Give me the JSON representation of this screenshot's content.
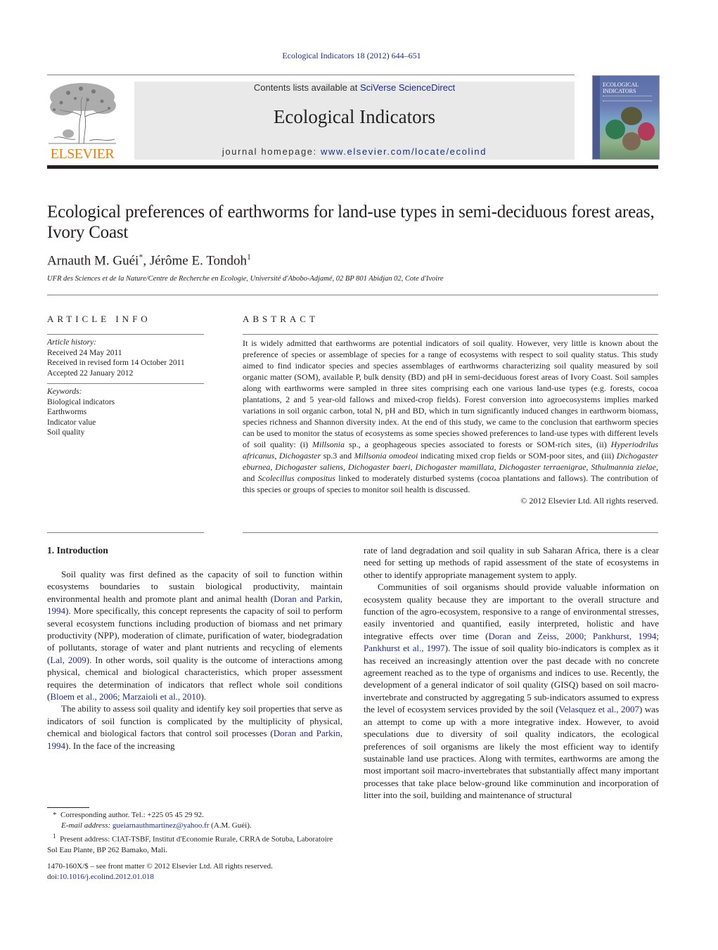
{
  "header": {
    "citation": "Ecological Indicators 18 (2012) 644–651",
    "publisher_logo_text": "ELSEVIER",
    "contents_prefix": "Contents lists available at ",
    "contents_link": "SciVerse ScienceDirect",
    "journal_title": "Ecological Indicators",
    "homepage_prefix": "journal homepage: ",
    "homepage_link": "www.elsevier.com/locate/ecolind",
    "cover_title_line1": "ECOLOGICAL",
    "cover_title_line2": "INDICATORS"
  },
  "article": {
    "title": "Ecological preferences of earthworms for land-use types in semi-deciduous forest areas, Ivory Coast",
    "authors": [
      {
        "name": "Arnauth M. Guéi",
        "mark": "*"
      },
      {
        "name": "Jérôme E. Tondoh",
        "mark": "1"
      }
    ],
    "author_separator": ", ",
    "affiliation": "UFR des Sciences et de la Nature/Centre de Recherche en Ecologie, Université d'Abobo-Adjamé, 02 BP 801 Abidjan 02, Cote d'Ivoire"
  },
  "article_info": {
    "heading": "ARTICLE INFO",
    "history_label": "Article history:",
    "history": [
      "Received 24 May 2011",
      "Received in revised form 14 October 2011",
      "Accepted 22 January 2012"
    ],
    "keywords_label": "Keywords:",
    "keywords": [
      "Biological indicators",
      "Earthworms",
      "Indicator value",
      "Soil quality"
    ]
  },
  "abstract": {
    "heading": "ABSTRACT",
    "segments": [
      {
        "t": "It is widely admitted that earthworms are potential indicators of soil quality. However, very little is known about the preference of species or assemblage of species for a range of ecosystems with respect to soil quality status. This study aimed to find indicator species and species assemblages of earthworms characterizing soil quality measured by soil organic matter (SOM), available P, bulk density (BD) and pH in semi-deciduous forest areas of Ivory Coast. Soil samples along with earthworms were sampled in three sites comprising each one various land-use types (e.g. forests, cocoa plantations, 2 and 5 year-old fallows and mixed-crop fields). Forest conversion into agroecosystems implies marked variations in soil organic carbon, total N, pH and BD, which in turn significantly induced changes in earthworm biomass, species richness and Shannon diversity index. At the end of this study, we came to the conclusion that earthworm species can be used to monitor the status of ecosystems as some species showed preferences to land-use types with different levels of soil quality: (i) ",
        "i": false
      },
      {
        "t": "Millsonia",
        "i": true
      },
      {
        "t": " sp., a geophageous species associated to forests or SOM-rich sites, (ii) ",
        "i": false
      },
      {
        "t": "Hyperiodrilus africanus",
        "i": true
      },
      {
        "t": ", ",
        "i": false
      },
      {
        "t": "Dichogaster",
        "i": true
      },
      {
        "t": " sp.3 and ",
        "i": false
      },
      {
        "t": "Millsonia omodeoi",
        "i": true
      },
      {
        "t": " indicating mixed crop fields or SOM-poor sites, and (iii) ",
        "i": false
      },
      {
        "t": "Dichogaster eburnea",
        "i": true
      },
      {
        "t": ", ",
        "i": false
      },
      {
        "t": "Dichogaster saliens",
        "i": true
      },
      {
        "t": ", ",
        "i": false
      },
      {
        "t": "Dichogaster baeri",
        "i": true
      },
      {
        "t": ", ",
        "i": false
      },
      {
        "t": "Dichogaster mamillata",
        "i": true
      },
      {
        "t": ", ",
        "i": false
      },
      {
        "t": "Dichogaster terraenigrae",
        "i": true
      },
      {
        "t": ", ",
        "i": false
      },
      {
        "t": "Sthulmannia zielae",
        "i": true
      },
      {
        "t": ", and ",
        "i": false
      },
      {
        "t": "Scolecillus compositus",
        "i": true
      },
      {
        "t": " linked to moderately disturbed systems (cocoa plantations and fallows). The contribution of this species or groups of species to monitor soil health is discussed.",
        "i": false
      }
    ],
    "copyright": "© 2012 Elsevier Ltd. All rights reserved."
  },
  "introduction": {
    "heading": "1.  Introduction",
    "paragraphs": [
      {
        "indent": true,
        "segments": [
          {
            "t": "Soil quality was first defined as the capacity of soil to function within ecosystems boundaries to sustain biological productivity, maintain environmental health and promote plant and animal health (",
            "ref": false
          },
          {
            "t": "Doran and Parkin, 1994",
            "ref": true
          },
          {
            "t": "). More specifically, this concept represents the capacity of soil to perform several ecosystem functions including production of biomass and net primary productivity (NPP), moderation of climate, purification of water, biodegradation of pollutants, storage of water and plant nutrients and recycling of elements (",
            "ref": false
          },
          {
            "t": "Lal, 2009",
            "ref": true
          },
          {
            "t": "). In other words, soil quality is the outcome of interactions among physical, chemical and biological characteristics, which proper assessment requires the determination of indicators that reflect whole soil conditions (",
            "ref": false
          },
          {
            "t": "Bloem et al., 2006; Marzaioli et al., 2010",
            "ref": true
          },
          {
            "t": ").",
            "ref": false
          }
        ]
      },
      {
        "indent": true,
        "segments": [
          {
            "t": "The ability to assess soil quality and identify key soil properties that serve as indicators of soil function is complicated by the multiplicity of physical, chemical and biological factors that control soil processes (",
            "ref": false
          },
          {
            "t": "Doran and Parkin, 1994",
            "ref": true
          },
          {
            "t": "). In the face of the increasing",
            "ref": false
          }
        ]
      }
    ],
    "right_paragraphs": [
      {
        "indent": false,
        "segments": [
          {
            "t": "rate of land degradation and soil quality in sub Saharan Africa, there is a clear need for setting up methods of rapid assessment of the state of ecosystems in other to identify appropriate management system to apply.",
            "ref": false
          }
        ]
      },
      {
        "indent": true,
        "segments": [
          {
            "t": "Communities of soil organisms should provide valuable information on ecosystem quality because they are important to the overall structure and function of the agro-ecosystem, responsive to a range of environmental stresses, easily inventoried and quantified, easily interpreted, holistic and have integrative effects over time (",
            "ref": false
          },
          {
            "t": "Doran and Zeiss, 2000; Pankhurst, 1994; Pankhurst et al., 1997",
            "ref": true
          },
          {
            "t": "). The issue of soil quality bio-indicators is complex as it has received an increasingly attention over the past decade with no concrete agreement reached as to the type of organisms and indices to use. Recently, the development of a general indicator of soil quality (GISQ) based on soil macro-invertebrate and constructed by aggregating 5 sub-indicators assumed to express the level of ecosystem services provided by the soil (",
            "ref": false
          },
          {
            "t": "Velasquez et al., 2007",
            "ref": true
          },
          {
            "t": ") was an attempt to come up with a more integrative index. However, to avoid speculations due to diversity of soil quality indicators, the ecological preferences of soil organisms are likely the most efficient way to identify sustainable land use practices. Along with termites, earthworms are among the most important soil macro-invertebrates that substantially affect many important processes that take place below-ground like comminution and incorporation of litter into the soil, building and maintenance of structural",
            "ref": false
          }
        ]
      }
    ]
  },
  "footnotes": {
    "corresponding_mark": "*",
    "corresponding_text": "Corresponding author. Tel.: +225 05 45 29 92.",
    "email_label": "E-mail address:",
    "email": "gueiarnauthmartinez@yahoo.fr",
    "email_suffix": " (A.M. Guéi).",
    "present_mark": "1",
    "present_text": "Present address: CIAT-TSBF, Institut d'Economie Rurale, CRRA de Sotuba, Laboratoire Sol Eau Plante, BP 262 Bamako, Mali."
  },
  "front_matter": {
    "issn_line": "1470-160X/$ – see front matter © 2012 Elsevier Ltd. All rights reserved.",
    "doi_prefix": "doi:",
    "doi": "10.1016/j.ecolind.2012.01.018"
  },
  "colors": {
    "link": "#1f2a8c",
    "elsevier_orange": "#f07d00",
    "banner_gray": "#e9e9e9",
    "text": "#231f20"
  }
}
